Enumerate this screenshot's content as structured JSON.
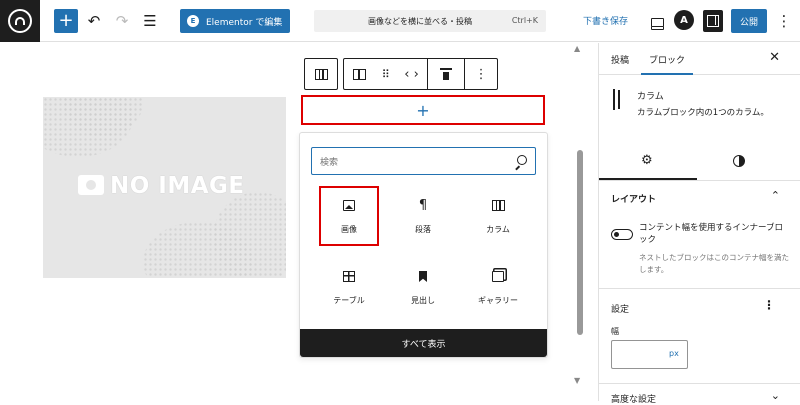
{
  "topbar": {
    "elementor_label": "Elementor で編集",
    "elementor_icon_letter": "E",
    "document_title": "画像などを横に並べる・投稿",
    "shortcut": "Ctrl+K",
    "draft_label": "下書き保存",
    "publish_label": "公開",
    "astra_letter": "A"
  },
  "canvas": {
    "noimage_text": "NO IMAGE",
    "appender_symbol": "+"
  },
  "inserter": {
    "search_placeholder": "検索",
    "items": [
      {
        "label": "画像",
        "icon": "image-icon",
        "highlighted": true
      },
      {
        "label": "段落",
        "icon": "paragraph-icon",
        "glyph": "¶"
      },
      {
        "label": "カラム",
        "icon": "columns-icon"
      },
      {
        "label": "テーブル",
        "icon": "table-icon"
      },
      {
        "label": "見出し",
        "icon": "heading-icon"
      },
      {
        "label": "ギャラリー",
        "icon": "gallery-icon"
      }
    ],
    "show_all_label": "すべて表示"
  },
  "sidebar": {
    "tab_post": "投稿",
    "tab_block": "ブロック",
    "block_name": "カラム",
    "block_desc": "カラムブロック内の1つのカラム。",
    "layout_heading": "レイアウト",
    "toggle_label": "コンテント幅を使用するインナーブロック",
    "toggle_help": "ネストしたブロックはこのコンテナ幅を満たします。",
    "settings_heading": "設定",
    "width_label": "幅",
    "width_unit": "px",
    "advanced_heading": "高度な設定"
  },
  "colors": {
    "accent": "#2271b1",
    "highlight": "#dd0000",
    "dark": "#1e1e1e"
  }
}
